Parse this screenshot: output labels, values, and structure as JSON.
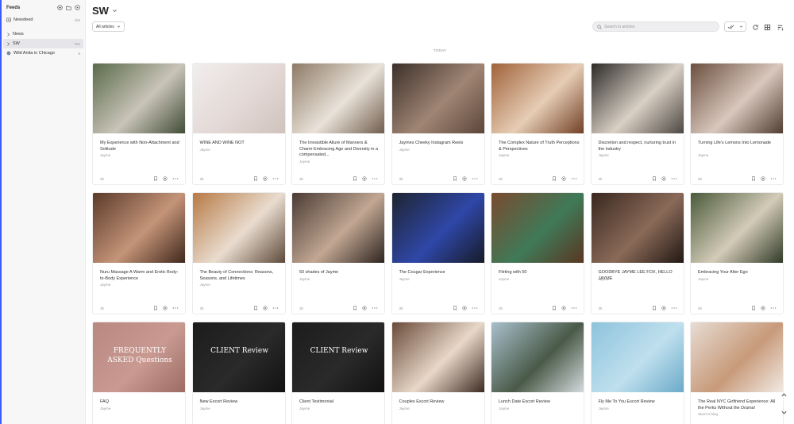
{
  "sidebar": {
    "title": "Feeds",
    "items": [
      {
        "label": "Newsfeed",
        "count": "1k5",
        "icon": "newspaper-icon"
      },
      {
        "label": "News",
        "count": "",
        "icon": "chevron-right-icon"
      },
      {
        "label": "SW",
        "count": "754",
        "icon": "chevron-right-icon",
        "active": true
      },
      {
        "label": "Wild Anita in Chicago",
        "count": "6",
        "icon": "site-favicon"
      }
    ]
  },
  "header": {
    "title": "SW",
    "filter_label": "All articles",
    "search_placeholder": "Search in articles"
  },
  "section_label": "TODAY",
  "colors": {
    "accent": "#3d5afe",
    "sidebar_bg": "#f7f7f8",
    "active_bg": "#e6e6ea"
  },
  "articles": [
    {
      "title": "My Experience with Non-Attachment and Solitude",
      "author": "Jayme",
      "age": "3h",
      "thumb": [
        "#5a6b4a",
        "#c9c4b9",
        "#3e4a33"
      ],
      "overlay": ""
    },
    {
      "title": "WINE AND WINE NOT",
      "author": "Jayme",
      "age": "3h",
      "thumb": [
        "#f1eeee",
        "#e3d8d5",
        "#cfc2bd"
      ],
      "overlay": ""
    },
    {
      "title": "The Irresistible Allure of Manners & Charm Embracing Age and Diversity in a compensated...",
      "author": "Jayme",
      "age": "3h",
      "thumb": [
        "#8d7a66",
        "#e9e2d9",
        "#6e5b4a"
      ],
      "overlay": ""
    },
    {
      "title": "Jaymes Cheeky Instagram Reels",
      "author": "Jayme",
      "age": "3h",
      "thumb": [
        "#3b302a",
        "#a08574",
        "#5a4438"
      ],
      "overlay": ""
    },
    {
      "title": "The Complex Nature of Truth Perceptions & Perspectives",
      "author": "Jayme",
      "age": "3h",
      "thumb": [
        "#a0623a",
        "#e6cdb5",
        "#6e3d22"
      ],
      "overlay": ""
    },
    {
      "title": "Discretion and respect, nurturing trust in the industry",
      "author": "Jayme",
      "age": "3h",
      "thumb": [
        "#2c2a28",
        "#d9d0c4",
        "#4a4440"
      ],
      "overlay": ""
    },
    {
      "title": "Turning Life's Lemons Into Lemonade",
      "author": "Jayme",
      "age": "3h",
      "thumb": [
        "#6b4f3e",
        "#d8c7bd",
        "#4d3a2e"
      ],
      "overlay": ""
    },
    {
      "title": "Nuru Massage A Warm and Erotic Body-to-Body Experience",
      "author": "Jayme",
      "age": "3h",
      "thumb": [
        "#5b3a2a",
        "#c49478",
        "#3d251a"
      ],
      "overlay": ""
    },
    {
      "title": "The Beauty of Connections: Reasons, Seasons, and Lifetimes",
      "author": "Jayme",
      "age": "3h",
      "thumb": [
        "#b77a45",
        "#e9dccf",
        "#5a4636"
      ],
      "overlay": ""
    },
    {
      "title": "50 shades of Jayme",
      "author": "Jayme",
      "age": "3h",
      "thumb": [
        "#4a3a34",
        "#c2a793",
        "#2a211d"
      ],
      "overlay": ""
    },
    {
      "title": "The Cougar Experience",
      "author": "Jayme",
      "age": "3h",
      "thumb": [
        "#1e2430",
        "#2f47a8",
        "#161a24"
      ],
      "overlay": ""
    },
    {
      "title": "Flirting with 50",
      "author": "Jayme",
      "age": "3h",
      "thumb": [
        "#7a4a2f",
        "#3f7a58",
        "#5a3420"
      ],
      "overlay": ""
    },
    {
      "title": "GOODBYE JAYME LEE FOX, HELLO JAYME",
      "author": "Jayme",
      "age": "3h",
      "thumb": [
        "#3a2820",
        "#8a6a58",
        "#1f1612"
      ],
      "overlay": ""
    },
    {
      "title": "Embracing Your Alter Ego",
      "author": "Jayme",
      "age": "3h",
      "thumb": [
        "#4a5a3a",
        "#d3cbb8",
        "#2d3624"
      ],
      "overlay": ""
    },
    {
      "title": "FAQ",
      "author": "Jayme",
      "age": "",
      "thumb": [
        "#b98880",
        "#c99a92",
        "#9a6a63"
      ],
      "overlay": "FREQUENTLY ASKED Questions"
    },
    {
      "title": "New Escort Review",
      "author": "Jayme",
      "age": "",
      "thumb": [
        "#1c1c1c",
        "#2a2a2a",
        "#111111"
      ],
      "overlay": "CLIENT Review"
    },
    {
      "title": "Client Testimonial",
      "author": "Jayme",
      "age": "",
      "thumb": [
        "#1c1c1c",
        "#2a2a2a",
        "#111111"
      ],
      "overlay": "CLIENT Review"
    },
    {
      "title": "Couples Escort Review",
      "author": "Jayme",
      "age": "",
      "thumb": [
        "#6a4a3a",
        "#e8d8c8",
        "#3a2820"
      ],
      "overlay": ""
    },
    {
      "title": "Lunch Date Escort Review",
      "author": "Jayme",
      "age": "",
      "thumb": [
        "#a8c0cc",
        "#4a5a48",
        "#d6dde0"
      ],
      "overlay": ""
    },
    {
      "title": "Fly Me To You Escort Review",
      "author": "Jayme",
      "age": "",
      "thumb": [
        "#8ec3dc",
        "#bfe0ee",
        "#6aa9c8"
      ],
      "overlay": ""
    },
    {
      "title": "The Real NYC Girlfriend Experience: All the Perks Without the Drama!",
      "author": "Storm's blog",
      "age": "",
      "thumb": [
        "#e7dcd3",
        "#c89a7a",
        "#f2ece6"
      ],
      "overlay": ""
    }
  ]
}
